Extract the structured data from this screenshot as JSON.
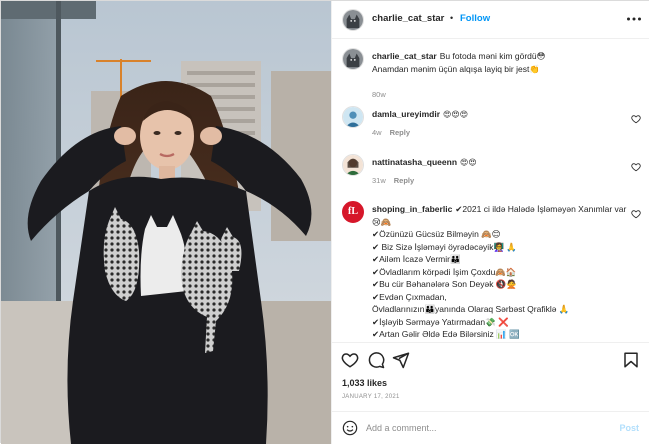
{
  "post": {
    "author": "charlie_cat_star",
    "follow_label": "Follow",
    "separator": "•"
  },
  "caption": {
    "user": "charlie_cat_star",
    "line1": "Bu fotoda məni kim gördü😳",
    "line2": "Anamdan mənim üçün alqışa layiq bir jest👏",
    "time": "80w"
  },
  "comments": [
    {
      "user": "damla_ureyimdir",
      "text": "😍😍😍",
      "time": "4w",
      "reply": "Reply"
    },
    {
      "user": "nattinatasha_queenn",
      "text": "😍😍",
      "time": "31w",
      "reply": "Reply"
    },
    {
      "user": "shoping_in_faberlic",
      "avatar_text": "fL",
      "intro": "✔2021 ci ildə Halədə İşləməyən Xanımlar var 😢🙈",
      "lines": [
        "✔Özünüzü Gücsüz Bilməyin 🙈😊",
        "✔ Biz Sizə İşləməyi öyrədəcəyik👩‍🏫 🙏",
        "✔Ailəm İcazə Vermir👪",
        "✔Övladlarım körpədi İşim Çoxdu🙈🏠",
        "✔Bu cür Bəhanələrə Son Deyək 🚯🙅",
        "✔Evdən Çıxmadan,",
        "Övladlarınızın👪yanında Olaraq Sərbəst Qrafiklə 🙏",
        "✔İşləyib Sərmayə Yatırmadan💸 ❌",
        "✔Artan Gəlir Əldə Edə Bilərsiniz 📊 🆗"
      ]
    }
  ],
  "stats": {
    "likes": "1,033 likes",
    "date": "JANUARY 17, 2021"
  },
  "add_comment": {
    "placeholder": "Add a comment...",
    "post_label": "Post"
  },
  "colors": {
    "link_blue": "#0095f6",
    "post_disabled": "#b2dffc",
    "muted": "#8e8e8e",
    "text": "#262626",
    "brand_red": "#d6172a"
  },
  "icons": [
    "more-options-icon",
    "heart-icon",
    "comment-icon",
    "share-icon",
    "bookmark-icon",
    "emoji-icon"
  ]
}
